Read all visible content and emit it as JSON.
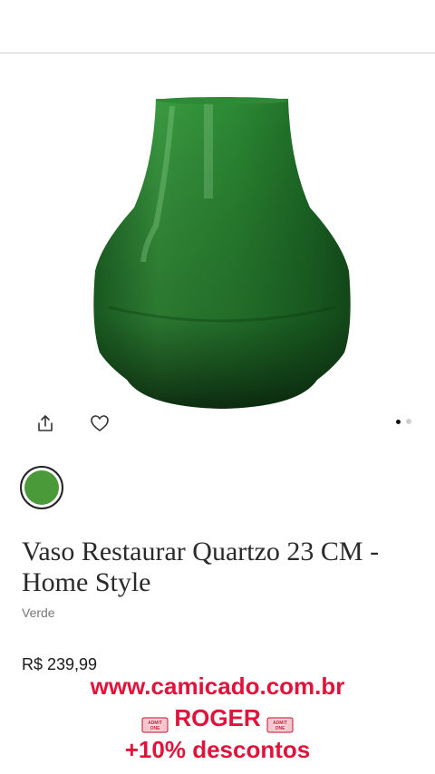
{
  "colors": {
    "accent_red": "#e0133a",
    "swatch_green": "#4a9a3a"
  },
  "gallery": {
    "image_icon": "green-glass-vase",
    "share_icon": "share-icon",
    "favorite_icon": "heart-icon",
    "page_count": 2,
    "active_page": 1
  },
  "product": {
    "title": "Vaso Restaurar Quartzo 23 CM - Home Style",
    "variant": "Verde",
    "price": "R$ 239,99"
  },
  "promo": {
    "url": "www.camicado.com.br",
    "code": "ROGER",
    "discount": "+10% descontos",
    "ticket_text": "ADMIT ONE"
  }
}
